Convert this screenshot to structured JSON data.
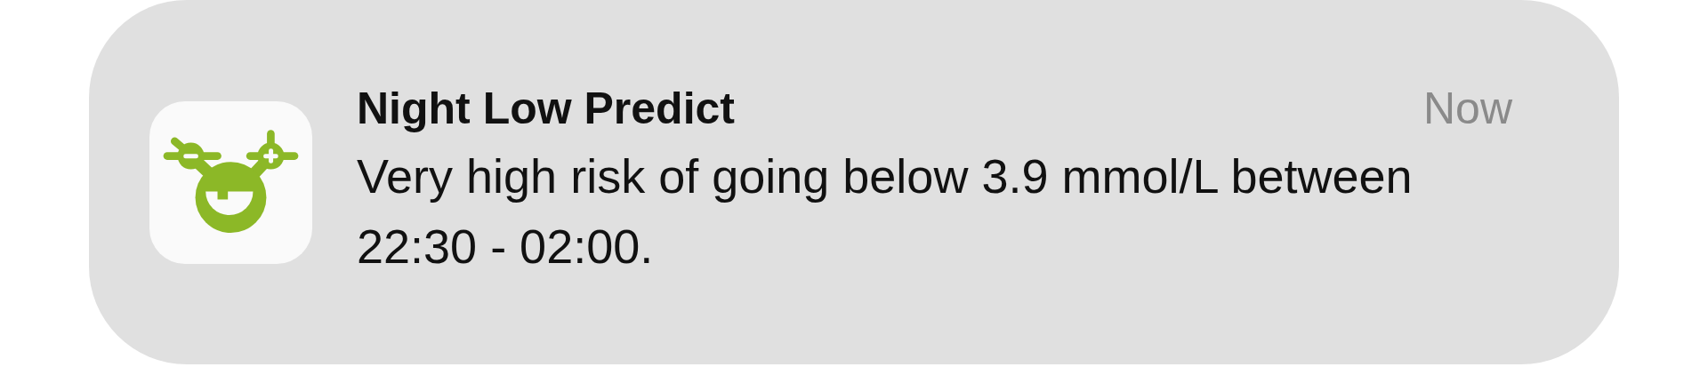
{
  "notification": {
    "title": "Night Low Predict",
    "time": "Now",
    "body": "Very high risk of going below 3.9 mmol/L between 22:30 - 02:00."
  }
}
